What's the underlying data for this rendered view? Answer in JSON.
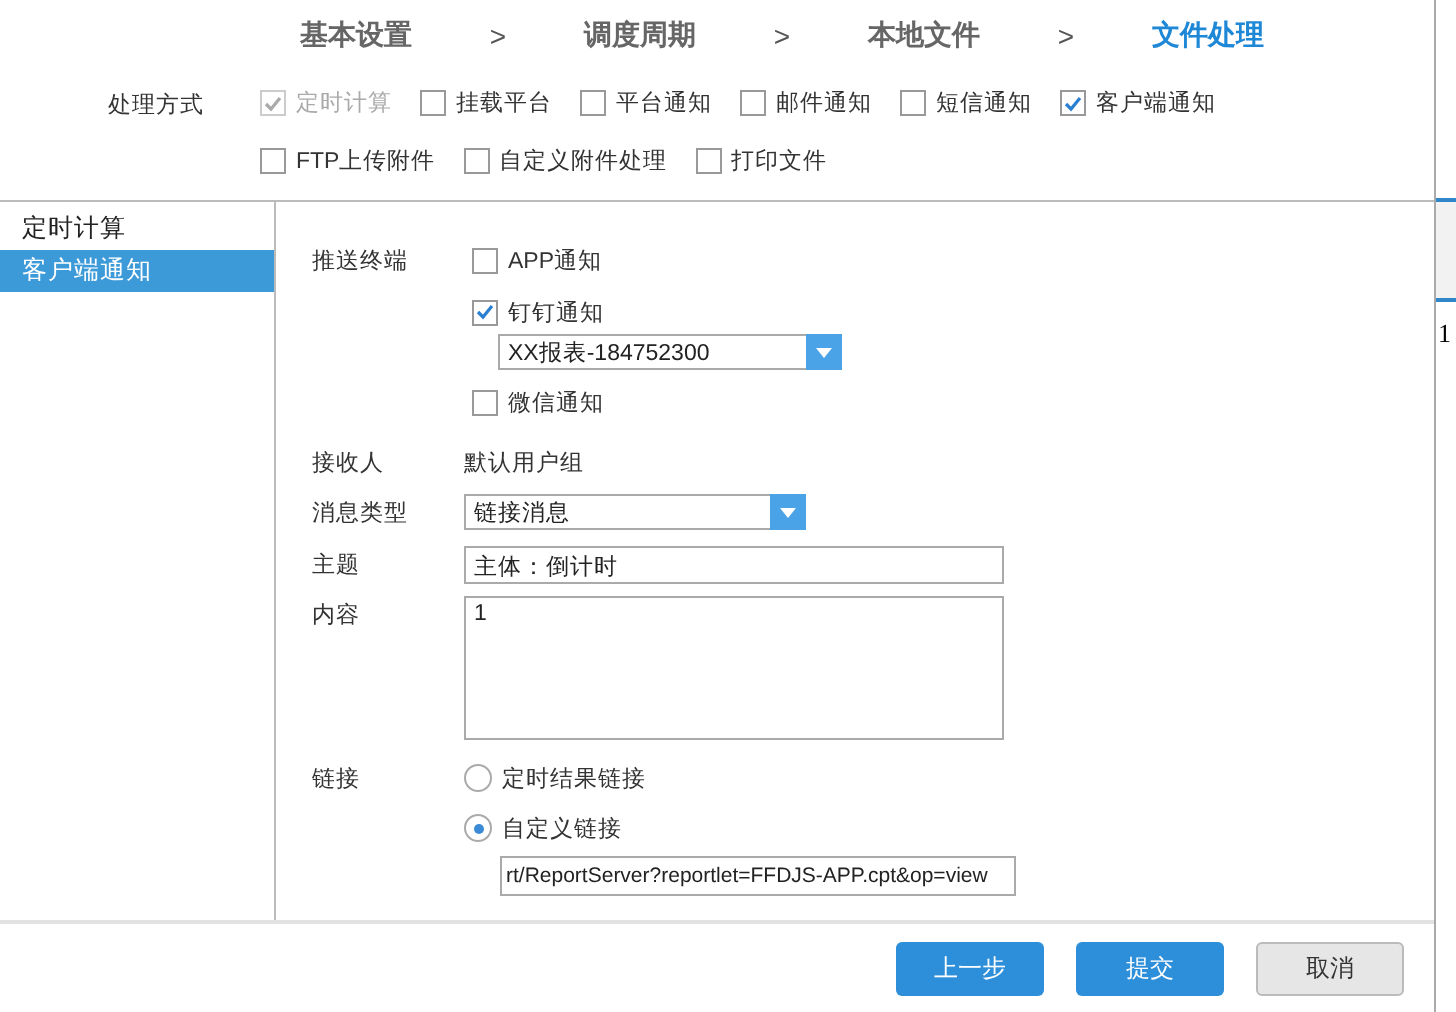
{
  "steps": [
    {
      "label": "基本设置",
      "selected": false
    },
    {
      "label": "调度周期",
      "selected": false
    },
    {
      "label": "本地文件",
      "selected": false
    },
    {
      "label": "文件处理",
      "selected": true
    }
  ],
  "step_separators": [
    ">",
    ">",
    ">"
  ],
  "processing": {
    "label": "处理方式",
    "options": [
      {
        "label": "定时计算",
        "checked": true,
        "disabled": true
      },
      {
        "label": "挂载平台",
        "checked": false,
        "disabled": false
      },
      {
        "label": "平台通知",
        "checked": false,
        "disabled": false
      },
      {
        "label": "邮件通知",
        "checked": false,
        "disabled": false
      },
      {
        "label": "短信通知",
        "checked": false,
        "disabled": false
      },
      {
        "label": "客户端通知",
        "checked": true,
        "disabled": false
      },
      {
        "label": "FTP上传附件",
        "checked": false,
        "disabled": false
      },
      {
        "label": "自定义附件处理",
        "checked": false,
        "disabled": false
      },
      {
        "label": "打印文件",
        "checked": false,
        "disabled": false
      }
    ]
  },
  "sidebar": {
    "items": [
      {
        "label": "定时计算",
        "selected": false
      },
      {
        "label": "客户端通知",
        "selected": true
      }
    ]
  },
  "form": {
    "push_terminal": {
      "label": "推送终端",
      "options": [
        {
          "label": "APP通知",
          "checked": false
        },
        {
          "label": "钉钉通知",
          "checked": true,
          "select_value": "XX报表-184752300"
        },
        {
          "label": "微信通知",
          "checked": false
        }
      ]
    },
    "recipient": {
      "label": "接收人",
      "value": "默认用户组"
    },
    "message_type": {
      "label": "消息类型",
      "value": "链接消息"
    },
    "subject": {
      "label": "主题",
      "value": "主体：倒计时"
    },
    "content": {
      "label": "内容",
      "value": "1"
    },
    "link": {
      "label": "链接",
      "options": [
        {
          "label": "定时结果链接",
          "selected": false
        },
        {
          "label": "自定义链接",
          "selected": true,
          "url": "rt/ReportServer?reportlet=FFDJS-APP.cpt&op=view"
        }
      ]
    }
  },
  "buttons": [
    {
      "label": "上一步",
      "kind": "primary"
    },
    {
      "label": "提交",
      "kind": "primary"
    },
    {
      "label": "取消",
      "kind": "secondary"
    }
  ],
  "background_text": "1"
}
